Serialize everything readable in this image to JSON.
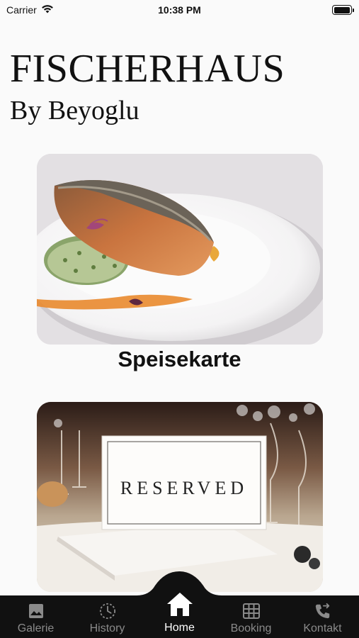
{
  "status_bar": {
    "carrier": "Carrier",
    "time": "10:38 PM",
    "battery_level": 1.0
  },
  "header": {
    "title": "FISCHERHAUS",
    "subtitle": "By Beyoglu"
  },
  "cards": [
    {
      "label": "Speisekarte",
      "image": "salmon-dish-photo"
    },
    {
      "label": "",
      "image": "reserved-table-sign-photo",
      "sign_text": "RESERVED"
    }
  ],
  "tabbar": {
    "active": "Home",
    "tabs": [
      {
        "label": "Galerie",
        "icon": "image-icon"
      },
      {
        "label": "History",
        "icon": "clock-icon"
      },
      {
        "label": "Home",
        "icon": "home-icon"
      },
      {
        "label": "Booking",
        "icon": "grid-icon"
      },
      {
        "label": "Kontakt",
        "icon": "phone-forward-icon"
      }
    ]
  },
  "colors": {
    "background": "#fafafa",
    "tabbar": "#111111",
    "tab_inactive": "#8a8a8a",
    "tab_active": "#ffffff"
  }
}
